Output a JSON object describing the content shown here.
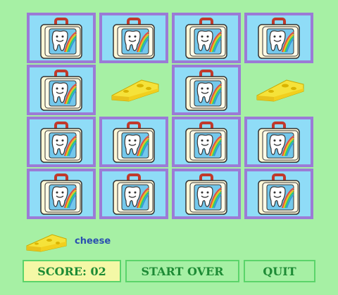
{
  "colors": {
    "background": "#a6f0a4",
    "card_border": "#9b7bd6",
    "card_face": "#8fdcf7",
    "button_text": "#1d8b35",
    "button_border": "#5bd46a",
    "score_bg": "#f4f8a6",
    "match_label": "#2a4fb0"
  },
  "board": {
    "rows": 4,
    "cols": 4,
    "cards": [
      {
        "state": "hidden",
        "icon": "tooth-lunchbox-icon"
      },
      {
        "state": "hidden",
        "icon": "tooth-lunchbox-icon"
      },
      {
        "state": "hidden",
        "icon": "tooth-lunchbox-icon"
      },
      {
        "state": "hidden",
        "icon": "tooth-lunchbox-icon"
      },
      {
        "state": "hidden",
        "icon": "tooth-lunchbox-icon"
      },
      {
        "state": "matched",
        "icon": "cheese-icon"
      },
      {
        "state": "hidden",
        "icon": "tooth-lunchbox-icon"
      },
      {
        "state": "matched",
        "icon": "cheese-icon"
      },
      {
        "state": "hidden",
        "icon": "tooth-lunchbox-icon"
      },
      {
        "state": "hidden",
        "icon": "tooth-lunchbox-icon"
      },
      {
        "state": "hidden",
        "icon": "tooth-lunchbox-icon"
      },
      {
        "state": "hidden",
        "icon": "tooth-lunchbox-icon"
      },
      {
        "state": "hidden",
        "icon": "tooth-lunchbox-icon"
      },
      {
        "state": "hidden",
        "icon": "tooth-lunchbox-icon"
      },
      {
        "state": "hidden",
        "icon": "tooth-lunchbox-icon"
      },
      {
        "state": "hidden",
        "icon": "tooth-lunchbox-icon"
      }
    ]
  },
  "last_match": {
    "icon": "cheese-icon",
    "label": "cheese"
  },
  "controls": {
    "score_label": "SCORE: 02",
    "start_over_label": "START OVER",
    "quit_label": "QUIT"
  }
}
